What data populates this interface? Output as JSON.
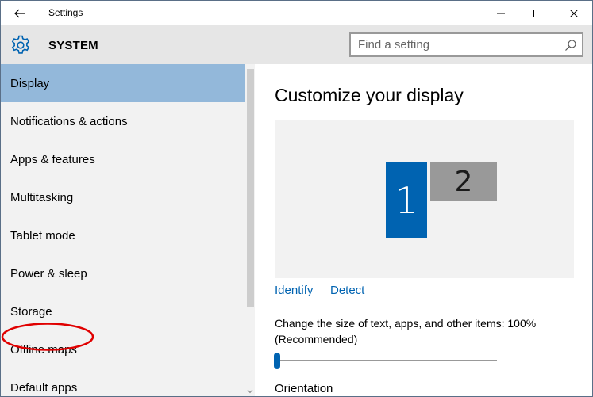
{
  "window": {
    "title": "Settings"
  },
  "header": {
    "section_title": "SYSTEM",
    "search": {
      "placeholder": "Find a setting"
    }
  },
  "sidebar": {
    "items": [
      {
        "label": "Display",
        "active": true
      },
      {
        "label": "Notifications & actions",
        "active": false
      },
      {
        "label": "Apps & features",
        "active": false
      },
      {
        "label": "Multitasking",
        "active": false
      },
      {
        "label": "Tablet mode",
        "active": false
      },
      {
        "label": "Power & sleep",
        "active": false,
        "annotated": true
      },
      {
        "label": "Storage",
        "active": false
      },
      {
        "label": "Offline maps",
        "active": false
      },
      {
        "label": "Default apps",
        "active": false
      }
    ]
  },
  "main": {
    "title": "Customize your display",
    "monitors": [
      {
        "number": "1",
        "selected": true
      },
      {
        "number": "2",
        "selected": false
      }
    ],
    "links": {
      "identify": "Identify",
      "detect": "Detect"
    },
    "scale_label": "Change the size of text, apps, and other items: 100% (Recommended)",
    "scale_slider_position": 0,
    "orientation_label": "Orientation"
  },
  "colors": {
    "accent": "#0063b1",
    "active_item_bg": "#93b8da",
    "header_bg": "#e6e6e6",
    "sidebar_bg": "#f2f2f2",
    "annotation_red": "#e00000"
  },
  "icons": {
    "back": "back-arrow-icon",
    "system": "gear-icon",
    "search": "search-icon",
    "minimize": "minimize-icon",
    "maximize": "maximize-icon",
    "close": "close-icon"
  }
}
